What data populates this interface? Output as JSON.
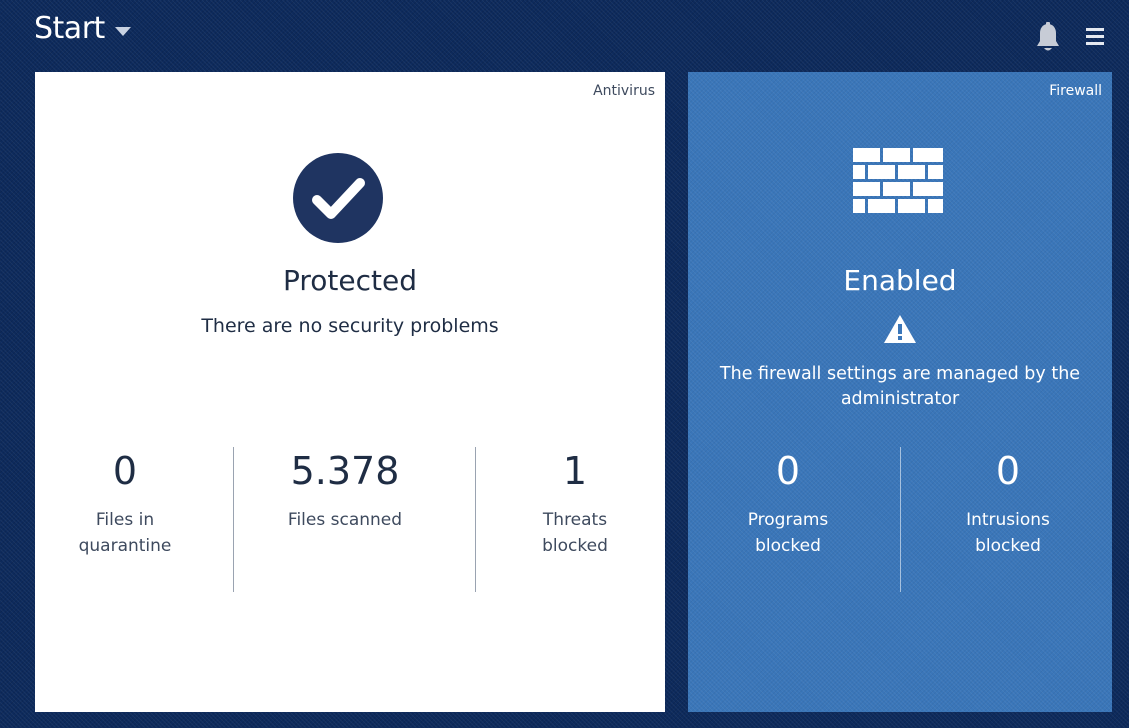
{
  "header": {
    "title": "Start",
    "notifications_icon": "bell-icon",
    "menu_icon": "hamburger-menu-icon"
  },
  "colors": {
    "background": "#0d2a5c",
    "antivirus_card": "#ffffff",
    "firewall_card": "#3a76b9",
    "check_circle": "#1f3461",
    "dark_text": "#1f2d44"
  },
  "antivirus": {
    "label": "Antivirus",
    "icon": "checkmark-circle-icon",
    "status": "Protected",
    "message": "There are no security problems",
    "stats": [
      {
        "value": "0",
        "label": "Files in quarantine"
      },
      {
        "value": "5.378",
        "label": "Files scanned"
      },
      {
        "value": "1",
        "label": "Threats blocked"
      }
    ]
  },
  "firewall": {
    "label": "Firewall",
    "icon": "brick-wall-icon",
    "status": "Enabled",
    "warning_icon": "warning-icon",
    "message": "The firewall settings are managed by the administrator",
    "stats": [
      {
        "value": "0",
        "label": "Programs blocked"
      },
      {
        "value": "0",
        "label": "Intrusions blocked"
      }
    ]
  }
}
